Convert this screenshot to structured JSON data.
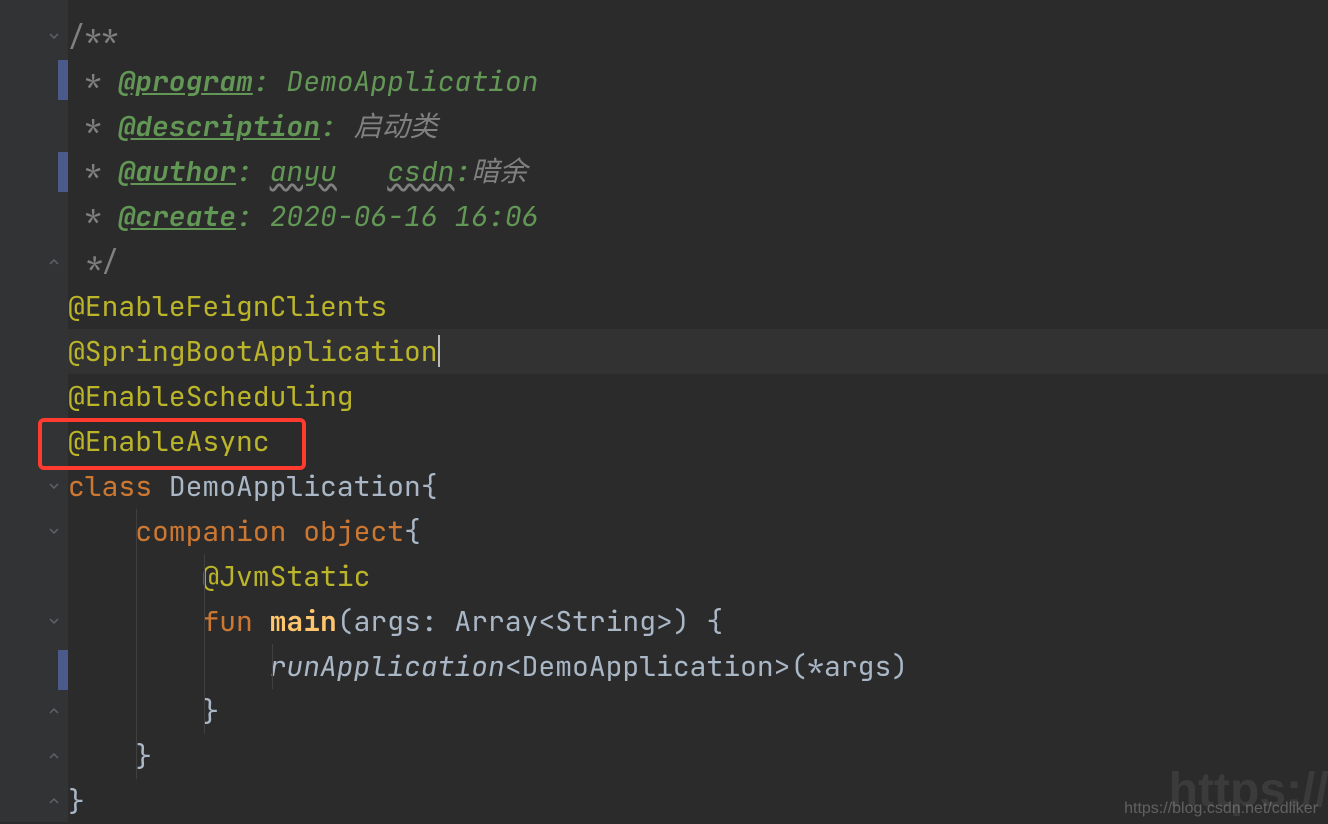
{
  "watermark": "https://blog.csdn.net/cdliker",
  "watermark2": "https://b",
  "code": {
    "l1": "/**",
    "l2_star": " * ",
    "l2_tag": "@program",
    "l2_rest": ": DemoApplication",
    "l3_star": " * ",
    "l3_tag": "@description",
    "l3_colon": ": ",
    "l3_val": "启动类",
    "l4_star": " * ",
    "l4_tag": "@author",
    "l4_colon": ": ",
    "l4_v1": "anyu",
    "l4_sp": "   ",
    "l4_v2": "csdn",
    "l4_colon2": ":",
    "l4_v3": "暗余",
    "l5_star": " * ",
    "l5_tag": "@create",
    "l5_rest": ": 2020-06-16 16:06",
    "l6": " */",
    "l7": "@EnableFeignClients",
    "l8": "@SpringBootApplication",
    "l9": "@EnableScheduling",
    "l10": "@EnableAsync",
    "l11_kw": "class ",
    "l11_name": "DemoApplication",
    "l11_br": "{",
    "l12_kw": "companion ",
    "l12_kw2": "object",
    "l12_br": "{",
    "l13": "@JvmStatic",
    "l14_kw": "fun ",
    "l14_fn": "main",
    "l14_p1": "(args: Array<",
    "l14_str": "String",
    "l14_p2": ">) {",
    "l15_fn": "runApplication",
    "l15_lt": "<",
    "l15_cls": "DemoApplication",
    "l15_gt": ">",
    "l15_args": "(*args)",
    "l16": "}",
    "l17": "}",
    "l18": "}"
  }
}
